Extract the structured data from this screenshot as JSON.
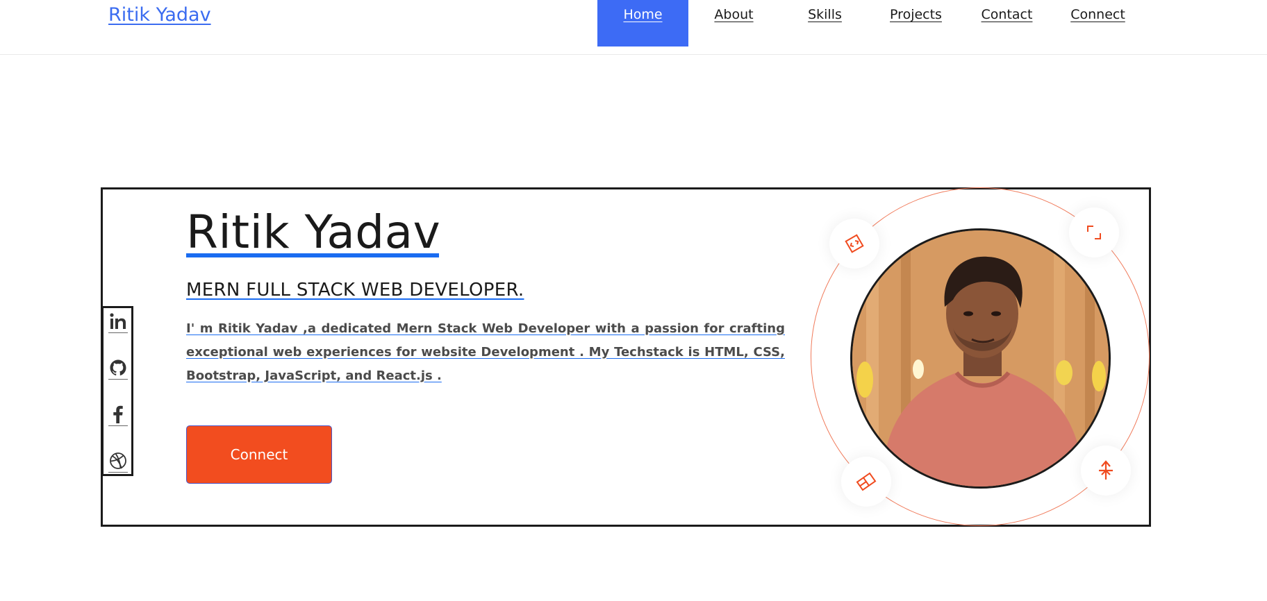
{
  "navbar": {
    "brand": "Ritik Yadav",
    "items": [
      {
        "label": "Home",
        "active": true
      },
      {
        "label": "About"
      },
      {
        "label": "Skills"
      },
      {
        "label": "Projects"
      },
      {
        "label": "Contact"
      },
      {
        "label": "Connect"
      }
    ]
  },
  "hero": {
    "name": "Ritik Yadav",
    "role": "MERN FULL STACK WEB DEVELOPER.",
    "description": "I' m Ritik Yadav ,a dedicated Mern Stack Web Developer with a passion for crafting exceptional web experiences for website Development . My Techstack is HTML, CSS, Bootstrap, JavaScript, and React.js .",
    "cta_label": "Connect"
  },
  "social": [
    "linkedin-icon",
    "github-icon",
    "facebook-icon",
    "dribbble-icon"
  ],
  "colors": {
    "brand_blue": "#3d6bf5",
    "accent_orange": "#f24d1f",
    "underline_blue": "#1a6cf1",
    "orbit_orange": "#f07a5a"
  }
}
